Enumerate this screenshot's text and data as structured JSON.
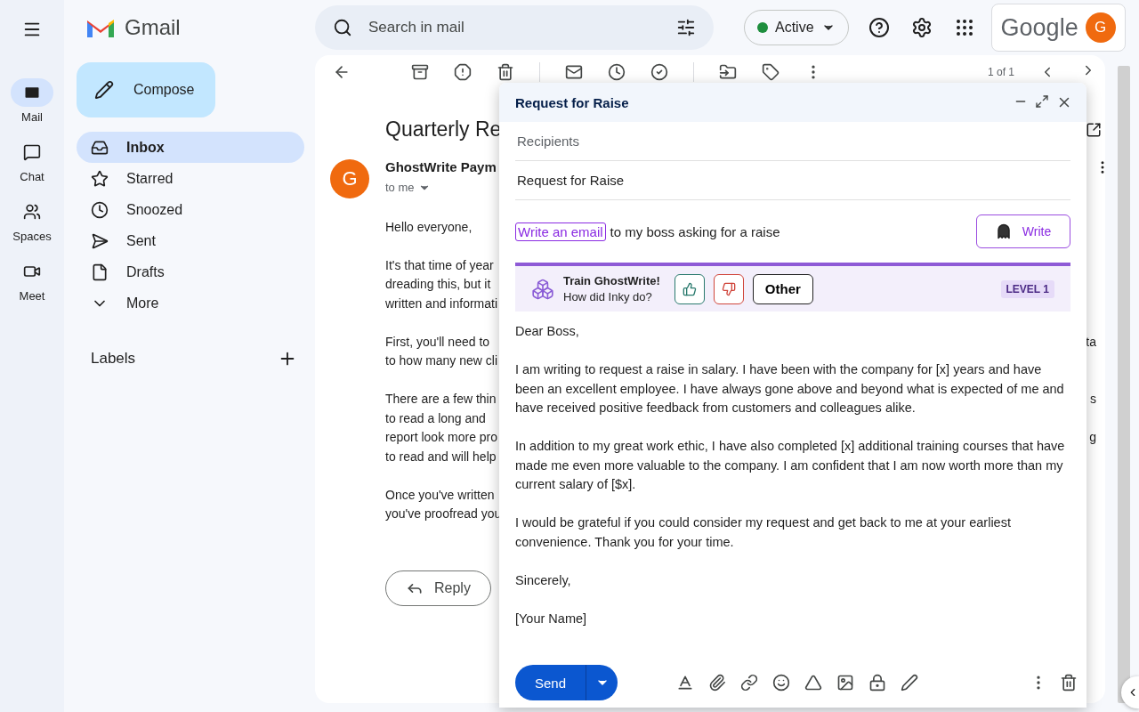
{
  "rail": {
    "items": [
      {
        "kind": "mail",
        "label": "Mail",
        "selected": true
      },
      {
        "kind": "chat",
        "label": "Chat",
        "selected": false
      },
      {
        "kind": "spaces",
        "label": "Spaces",
        "selected": false
      },
      {
        "kind": "meet",
        "label": "Meet",
        "selected": false
      }
    ]
  },
  "brand": {
    "name": "Gmail"
  },
  "search": {
    "placeholder": "Search in mail"
  },
  "status": {
    "label": "Active"
  },
  "account": {
    "brand": "Google",
    "avatar": "G"
  },
  "nav": {
    "compose": "Compose",
    "items": [
      {
        "kind": "inbox",
        "label": "Inbox",
        "selected": true
      },
      {
        "kind": "starred",
        "label": "Starred",
        "selected": false
      },
      {
        "kind": "snoozed",
        "label": "Snoozed",
        "selected": false
      },
      {
        "kind": "sent",
        "label": "Sent",
        "selected": false
      },
      {
        "kind": "drafts",
        "label": "Drafts",
        "selected": false
      },
      {
        "kind": "more",
        "label": "More",
        "selected": false
      }
    ],
    "labels_heading": "Labels"
  },
  "message": {
    "pager": "1 of 1",
    "subject": "Quarterly Re",
    "sender": "GhostWrite Paym",
    "avatar": "G",
    "recipient": "to me",
    "paragraphs": [
      [
        {
          "left": "Hello everyone,"
        }
      ],
      [
        {
          "left": "It's that time of year"
        },
        {
          "left": "dreading this, but it"
        },
        {
          "left": "written and informati"
        }
      ],
      [
        {
          "left": "First, you'll need to",
          "right": "ta"
        },
        {
          "left": "to how many new cli"
        }
      ],
      [
        {
          "left": "There are a few thin",
          "right": "s"
        },
        {
          "left": "to read a long and"
        },
        {
          "left": "report look more pro",
          "right": "g"
        },
        {
          "left": "to read and will help"
        }
      ],
      [
        {
          "left": "Once you've written"
        },
        {
          "left": "you've proofread you"
        }
      ]
    ],
    "reply": "Reply"
  },
  "compose": {
    "title": "Request for Raise",
    "recipients_placeholder": "Recipients",
    "subject": "Request for Raise",
    "prompt": {
      "highlight": "Write an email",
      "rest": "to my boss asking for a raise"
    },
    "write_button": "Write",
    "train": {
      "title": "Train GhostWrite!",
      "question": "How did Inky do?",
      "other": "Other",
      "level": "LEVEL 1"
    },
    "body": [
      "Dear Boss,",
      "I am writing to request a raise in salary. I have been with the company for [x] years and have been an excellent employee. I have always gone above and beyond what is expected of me and have received positive feedback from customers and colleagues alike.",
      "In addition to my great work ethic, I have also completed [x] additional training courses that have made me even more valuable to the company. I am confident that I am now worth more than my current salary of [$x].",
      "I would be grateful if you could consider my request and get back to me at your earliest convenience. Thank you for your time.",
      "Sincerely,",
      "[Your Name]"
    ],
    "send": "Send"
  }
}
